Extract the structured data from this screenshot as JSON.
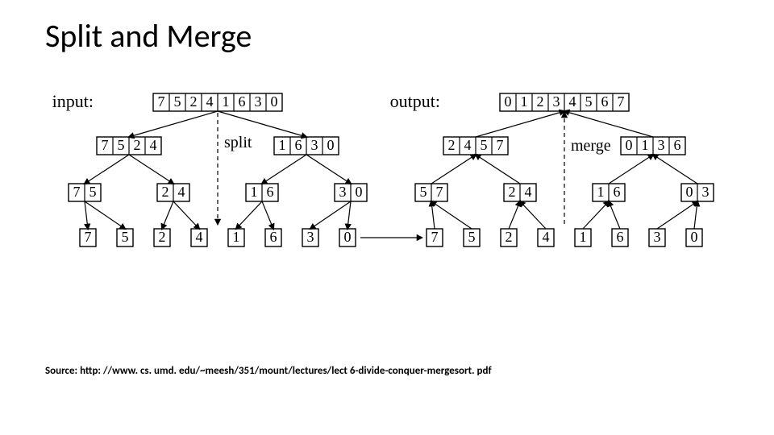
{
  "title": "Split and Merge",
  "source_prefix": "Source: ",
  "source_url": "http: //www. cs. umd. edu/~meesh/351/mount/lectures/lect 6-divide-conquer-mergesort. pdf",
  "labels": {
    "input": "input:",
    "output": "output:",
    "split": "split",
    "merge": "merge"
  },
  "split_tree": {
    "label_pos": "left",
    "root": [
      "7",
      "5",
      "2",
      "4",
      "1",
      "6",
      "3",
      "0"
    ],
    "level1": [
      [
        "7",
        "5",
        "2",
        "4"
      ],
      [
        "1",
        "6",
        "3",
        "0"
      ]
    ],
    "level2": [
      [
        "7",
        "5"
      ],
      [
        "2",
        "4"
      ],
      [
        "1",
        "6"
      ],
      [
        "3",
        "0"
      ]
    ],
    "leaves": [
      "7",
      "5",
      "2",
      "4",
      "1",
      "6",
      "3",
      "0"
    ]
  },
  "merge_tree": {
    "label_pos": "left",
    "root": [
      "0",
      "1",
      "2",
      "3",
      "4",
      "5",
      "6",
      "7"
    ],
    "level1": [
      [
        "2",
        "4",
        "5",
        "7"
      ],
      [
        "0",
        "1",
        "3",
        "6"
      ]
    ],
    "level2": [
      [
        "5",
        "7"
      ],
      [
        "2",
        "4"
      ],
      [
        "1",
        "6"
      ],
      [
        "0",
        "3"
      ]
    ],
    "leaves": [
      "7",
      "5",
      "2",
      "4",
      "1",
      "6",
      "3",
      "0"
    ]
  }
}
